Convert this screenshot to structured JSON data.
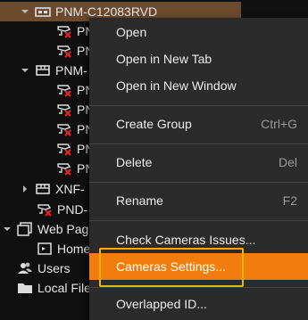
{
  "tree": {
    "device1": {
      "label": "PNM-C12083RVD"
    },
    "device1_children": [
      "PN",
      "PN"
    ],
    "device2": {
      "label": "PNM-"
    },
    "device2_children": [
      "PN",
      "PN",
      "PN",
      "PN",
      "PN"
    ],
    "device3": {
      "label": "XNF-"
    },
    "device4": {
      "label": "PND-"
    },
    "web_pages": {
      "label": "Web Pag"
    },
    "home": {
      "label": "Home"
    },
    "users": {
      "label": "Users"
    },
    "local_files": {
      "label": "Local File"
    }
  },
  "context_menu": {
    "open": "Open",
    "open_new_tab": "Open in New Tab",
    "open_new_window": "Open in New Window",
    "create_group": "Create Group",
    "create_group_shortcut": "Ctrl+G",
    "delete": "Delete",
    "delete_shortcut": "Del",
    "rename": "Rename",
    "rename_shortcut": "F2",
    "check_cameras_issues": "Check Cameras Issues...",
    "cameras_settings": "Cameras Settings...",
    "overlapped_id": "Overlapped ID..."
  },
  "colors": {
    "highlight": "#f07d0e",
    "focus_outline": "#f5b400",
    "selected_row": "#6b4a2d",
    "error_x": "#e8231c"
  }
}
